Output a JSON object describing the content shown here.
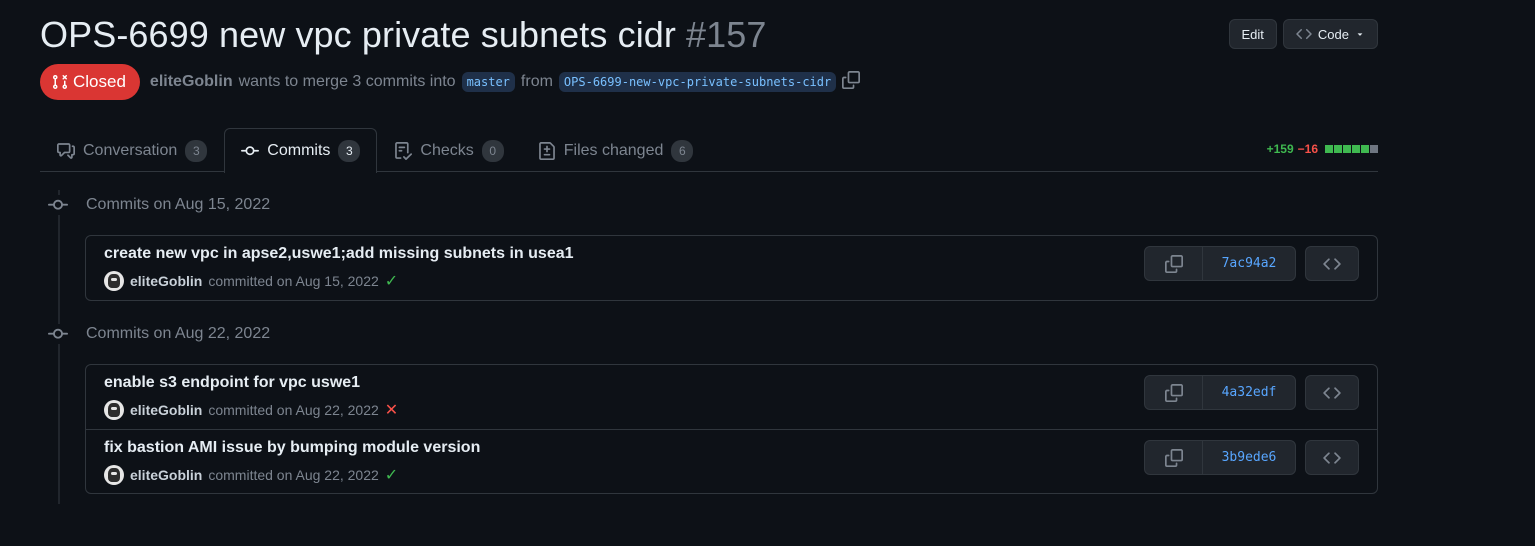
{
  "pr": {
    "title": "OPS-6699 new vpc private subnets cidr",
    "number": "#157",
    "state": "Closed",
    "author": "eliteGoblin",
    "summary": "wants to merge 3 commits into",
    "base_branch": "master",
    "from_text": "from",
    "head_branch": "OPS-6699-new-vpc-private-subnets-cidr"
  },
  "header_buttons": {
    "edit": "Edit",
    "code": "Code"
  },
  "tabs": [
    {
      "label": "Conversation",
      "count": "3",
      "icon": "comment-discussion-icon"
    },
    {
      "label": "Commits",
      "count": "3",
      "icon": "git-commit-icon"
    },
    {
      "label": "Checks",
      "count": "0",
      "icon": "checklist-icon"
    },
    {
      "label": "Files changed",
      "count": "6",
      "icon": "file-diff-icon"
    }
  ],
  "diffstat": {
    "additions": "+159",
    "deletions": "−16",
    "blocks": [
      "green",
      "green",
      "green",
      "green",
      "green",
      "gray"
    ]
  },
  "colors": {
    "closed": "#da3633",
    "add": "#3fb950",
    "del": "#f85149",
    "link": "#58a6ff"
  },
  "groups": [
    {
      "heading": "Commits on Aug 15, 2022",
      "commits": [
        {
          "message": "create new vpc in apse2,uswe1;add missing subnets in usea1",
          "author": "eliteGoblin",
          "committed": "committed on Aug 15, 2022",
          "status": "success",
          "sha": "7ac94a2"
        }
      ]
    },
    {
      "heading": "Commits on Aug 22, 2022",
      "commits": [
        {
          "message": "enable s3 endpoint for vpc uswe1",
          "author": "eliteGoblin",
          "committed": "committed on Aug 22, 2022",
          "status": "failure",
          "sha": "4a32edf"
        },
        {
          "message": "fix bastion AMI issue by bumping module version",
          "author": "eliteGoblin",
          "committed": "committed on Aug 22, 2022",
          "status": "success",
          "sha": "3b9ede6"
        }
      ]
    }
  ]
}
